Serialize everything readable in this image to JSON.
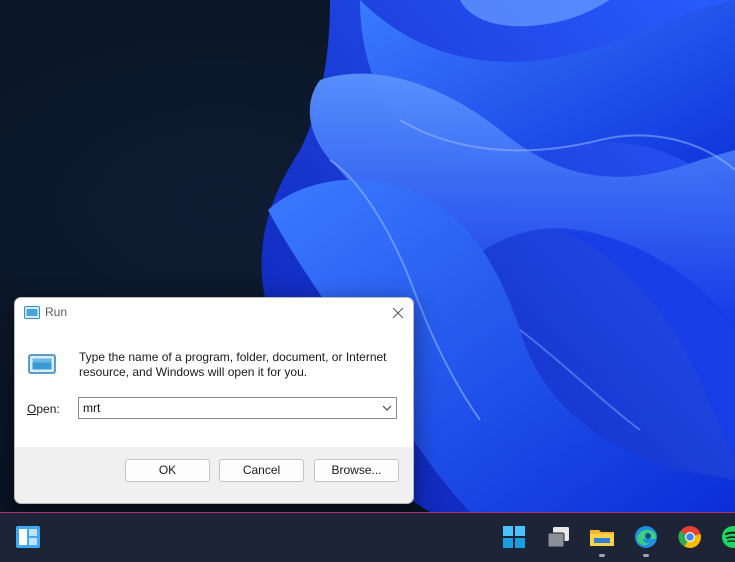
{
  "dialog": {
    "title": "Run",
    "description": "Type the name of a program, folder, document, or Internet resource, and Windows will open it for you.",
    "open_label_access": "O",
    "open_label_rest": "pen:",
    "open_value": "mrt",
    "ok_label": "OK",
    "cancel_label": "Cancel",
    "browse_label": "Browse..."
  },
  "taskbar": {
    "items": [
      "widgets-icon",
      "start-icon",
      "task-view-icon",
      "file-explorer-icon",
      "edge-icon",
      "chrome-icon",
      "spotify-icon"
    ]
  },
  "colors": {
    "accent_border": "#b0307a",
    "wallpaper_blue": "#1f4dff",
    "dialog_bg": "#f0f0f0"
  }
}
